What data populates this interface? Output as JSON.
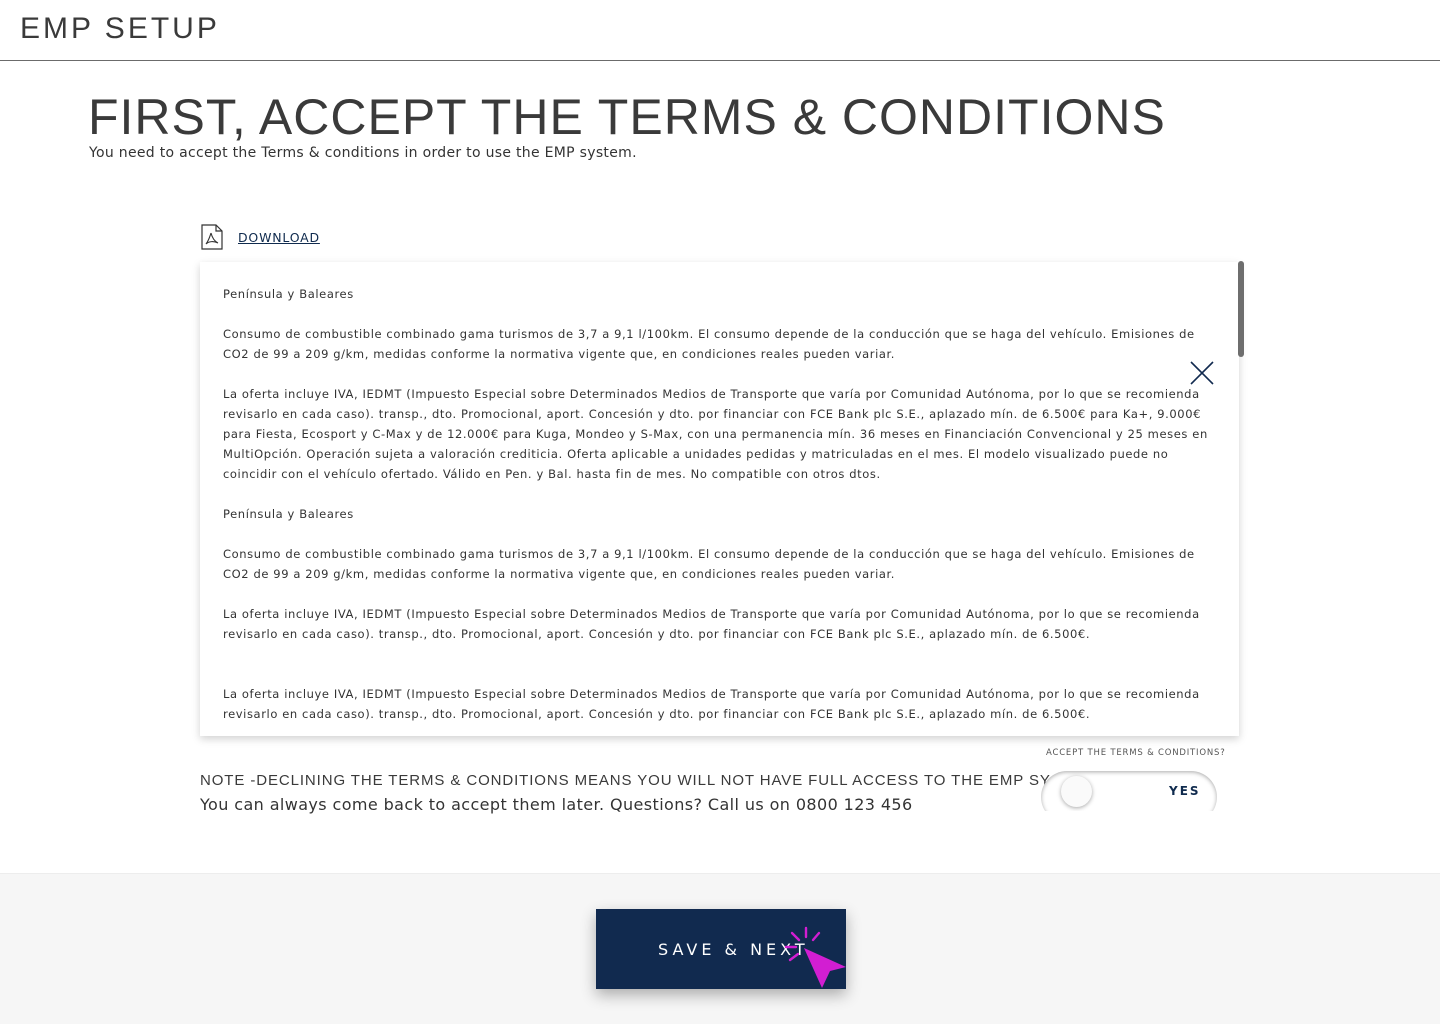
{
  "header": {
    "app_title": "EMP SETUP"
  },
  "page": {
    "title": "FIRST, ACCEPT THE TERMS & CONDITIONS",
    "subtitle": "You need to accept the Terms & conditions in order to use the EMP system."
  },
  "download": {
    "label": "DOWNLOAD",
    "icon": "pdf-file-icon"
  },
  "terms": {
    "paragraphs": [
      "Península y Baleares",
      "Consumo de combustible combinado gama turismos de 3,7 a 9,1 l/100km. El consumo depende de la conducción que se haga del vehículo. Emisiones de CO2 de 99 a 209 g/km, medidas conforme la normativa vigente que, en condiciones reales pueden variar.",
      "La oferta incluye IVA, IEDMT (Impuesto Especial sobre Determinados Medios de Transporte que varía por Comunidad Autónoma, por lo que se recomienda revisarlo en cada caso). transp., dto. Promocional, aport. Concesión y dto. por financiar con FCE Bank plc S.E., aplazado mín. de 6.500€ para Ka+, 9.000€ para Fiesta, Ecosport y C-Max y de 12.000€ para Kuga, Mondeo y S-Max, con una permanencia mín. 36 meses en Financiación Convencional y 25 meses en MultiOpción. Operación sujeta a valoración crediticia. Oferta aplicable a unidades pedidas y matriculadas en el mes. El modelo visualizado puede no coincidir con el vehículo ofertado. Válido en Pen. y Bal. hasta fin de mes. No compatible con otros dtos.",
      "Península y Baleares",
      "Consumo de combustible combinado gama turismos de 3,7 a 9,1 l/100km. El consumo depende de la conducción que se haga del vehículo. Emisiones de CO2 de 99 a 209 g/km, medidas conforme la normativa vigente que, en condiciones reales pueden variar.",
      "La oferta incluye IVA, IEDMT (Impuesto Especial sobre Determinados Medios de Transporte que varía por Comunidad Autónoma, por lo que se recomienda revisarlo en cada caso). transp., dto. Promocional, aport. Concesión y dto. por financiar con FCE Bank plc S.E., aplazado mín. de 6.500€.",
      "La oferta incluye IVA, IEDMT (Impuesto Especial sobre Determinados Medios de Transporte que varía por Comunidad Autónoma, por lo que se recomienda revisarlo en cada caso). transp., dto. Promocional, aport. Concesión y dto. por financiar con FCE Bank plc S.E., aplazado mín. de 6.500€."
    ],
    "close_icon": "close-icon"
  },
  "note": {
    "title": "NOTE -DECLINING THE TERMS & CONDITIONS MEANS YOU WILL NOT HAVE FULL ACCESS TO THE EMP SYSTEM",
    "body": "You can always come back to accept them later. Questions? Call us on 0800 123 456"
  },
  "accept": {
    "label": "ACCEPT THE TERMS & CONDITIONS?",
    "toggle_text": "YES"
  },
  "footer": {
    "save_label": "SAVE & NEXT"
  },
  "colors": {
    "primary": "#112a4f",
    "cursor": "#d21ed2",
    "footer_bg": "#f6f6f6"
  }
}
